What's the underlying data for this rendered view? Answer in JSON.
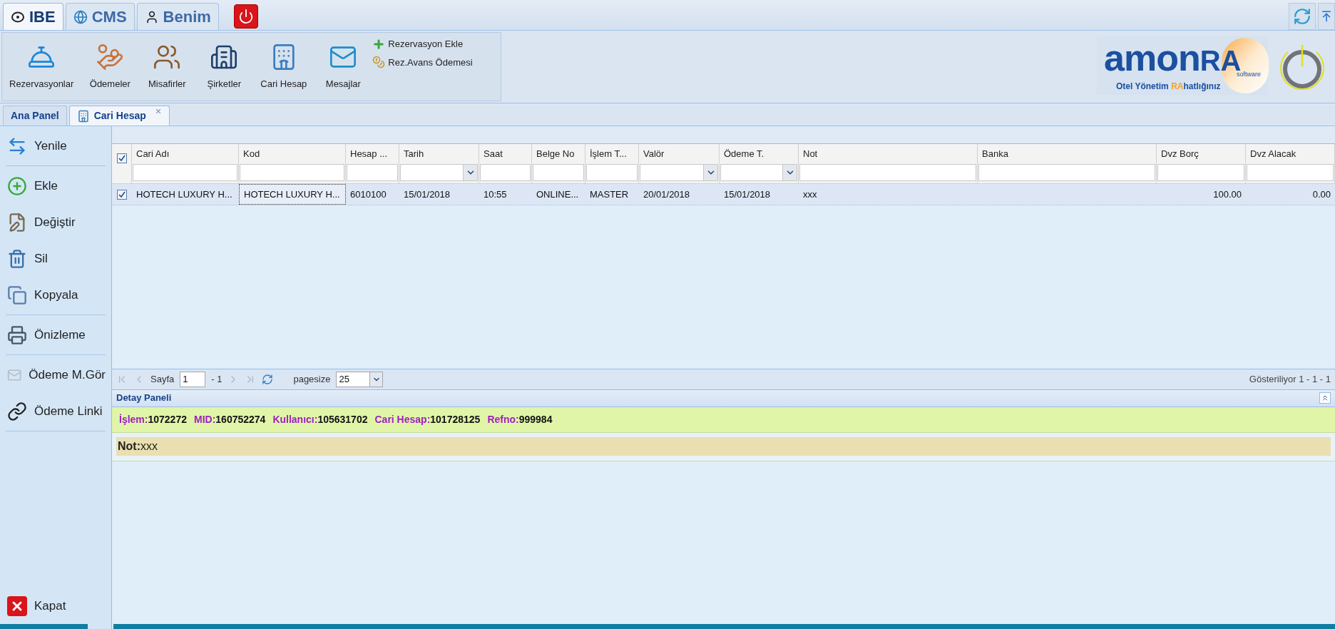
{
  "top_tabs": [
    {
      "label": "IBE",
      "selected": true
    },
    {
      "label": "CMS",
      "selected": false
    },
    {
      "label": "Benim",
      "selected": false
    }
  ],
  "ribbon": {
    "items": [
      "Rezervasyonlar",
      "Ödemeler",
      "Misafirler",
      "Şirketler",
      "Cari Hesap",
      "Mesajlar"
    ],
    "side_actions": [
      "Rezervasyon Ekle",
      "Rez.Avans Ödemesi"
    ]
  },
  "logo": {
    "word": "amon",
    "accent": "RA",
    "small": "software",
    "tagline_before": "Otel Yönetim ",
    "tagline_accent": "RA",
    "tagline_after": "hatlığınız"
  },
  "page_tabs": [
    {
      "label": "Ana Panel",
      "selected": false,
      "closable": false
    },
    {
      "label": "Cari Hesap",
      "selected": true,
      "closable": true
    }
  ],
  "sidebar": {
    "groups": [
      [
        "Yenile"
      ],
      [
        "Ekle",
        "Değiştir",
        "Sil",
        "Kopyala"
      ],
      [
        "Önizleme"
      ],
      [
        "Ödeme M.Gör",
        "Ödeme Linki"
      ]
    ],
    "bottom": "Kapat"
  },
  "grid": {
    "all_checked": true,
    "columns": [
      {
        "label": "Cari Adı",
        "kind": "text"
      },
      {
        "label": "Kod",
        "kind": "text"
      },
      {
        "label": "Hesap ...",
        "kind": "text"
      },
      {
        "label": "Tarih",
        "kind": "date"
      },
      {
        "label": "Saat",
        "kind": "text"
      },
      {
        "label": "Belge No",
        "kind": "text"
      },
      {
        "label": "İşlem T...",
        "kind": "text"
      },
      {
        "label": "Valör",
        "kind": "date"
      },
      {
        "label": "Ödeme T.",
        "kind": "date"
      },
      {
        "label": "Not",
        "kind": "text"
      },
      {
        "label": "Banka",
        "kind": "text"
      },
      {
        "label": "Dvz Borç",
        "kind": "number"
      },
      {
        "label": "Dvz Alacak",
        "kind": "number"
      }
    ],
    "rows": [
      {
        "checked": true,
        "selected": true,
        "cells": [
          {
            "text": "HOTECH LUXURY H...",
            "focused": false
          },
          {
            "text": "HOTECH LUXURY H...",
            "focused": true
          },
          {
            "text": "6010100",
            "focused": false
          },
          {
            "text": "15/01/2018",
            "focused": false
          },
          {
            "text": "10:55",
            "focused": false
          },
          {
            "text": "ONLINE...",
            "focused": false
          },
          {
            "text": "MASTER",
            "focused": false
          },
          {
            "text": "20/01/2018",
            "focused": false
          },
          {
            "text": "15/01/2018",
            "focused": false
          },
          {
            "text": "xxx",
            "focused": false
          },
          {
            "focused": false
          },
          {
            "text": "100.00",
            "focused": false
          },
          {
            "text": "0.00",
            "focused": false
          }
        ]
      }
    ]
  },
  "pager": {
    "nav_disabled": true,
    "page_label": "Sayfa",
    "page": "1",
    "page_total": "- 1",
    "pagesize_label": "pagesize",
    "pagesize": "25",
    "status": "Gösteriliyor 1 - 1 - 1"
  },
  "detail": {
    "title": "Detay Paneli",
    "fields": [
      {
        "label": "İşlem:",
        "value": "1072272"
      },
      {
        "label": "MID:",
        "value": "160752274"
      },
      {
        "label": "Kullanıcı:",
        "value": "105631702"
      },
      {
        "label": "Cari Hesap:",
        "value": "101728125"
      },
      {
        "label": "Refno:",
        "value": "999984"
      }
    ],
    "note_label": "Not:",
    "note_value": "xxx"
  }
}
